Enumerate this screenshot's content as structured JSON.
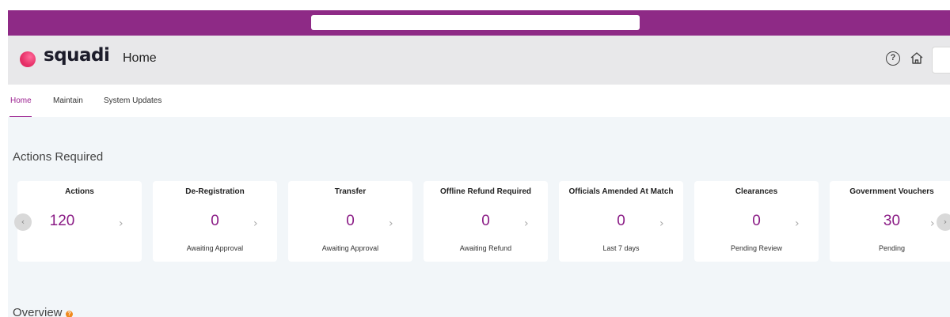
{
  "header": {
    "logo_text": "squadi",
    "title": "Home",
    "help_icon": "question-circle-icon",
    "home_icon": "home-icon"
  },
  "tabs": [
    {
      "label": "Home",
      "active": true
    },
    {
      "label": "Maintain",
      "active": false
    },
    {
      "label": "System Updates",
      "active": false
    }
  ],
  "actions_required": {
    "title": "Actions Required",
    "cards": [
      {
        "title": "Actions",
        "value": "120",
        "subtitle": ""
      },
      {
        "title": "De-Registration",
        "value": "0",
        "subtitle": "Awaiting Approval"
      },
      {
        "title": "Transfer",
        "value": "0",
        "subtitle": "Awaiting Approval"
      },
      {
        "title": "Offline Refund Required",
        "value": "0",
        "subtitle": "Awaiting Refund"
      },
      {
        "title": "Officials Amended At Match",
        "value": "0",
        "subtitle": "Last 7 days"
      },
      {
        "title": "Clearances",
        "value": "0",
        "subtitle": "Pending Review"
      },
      {
        "title": "Government Vouchers",
        "value": "30",
        "subtitle": "Pending"
      }
    ],
    "chevron": "›",
    "prev_glyph": "‹",
    "next_glyph": "›"
  },
  "overview": {
    "title": "Overview",
    "help_glyph": "?"
  },
  "colors": {
    "brand_purple": "#8e2a86",
    "value_purple": "#8a1b85",
    "accent_orange": "#f08a1e"
  }
}
